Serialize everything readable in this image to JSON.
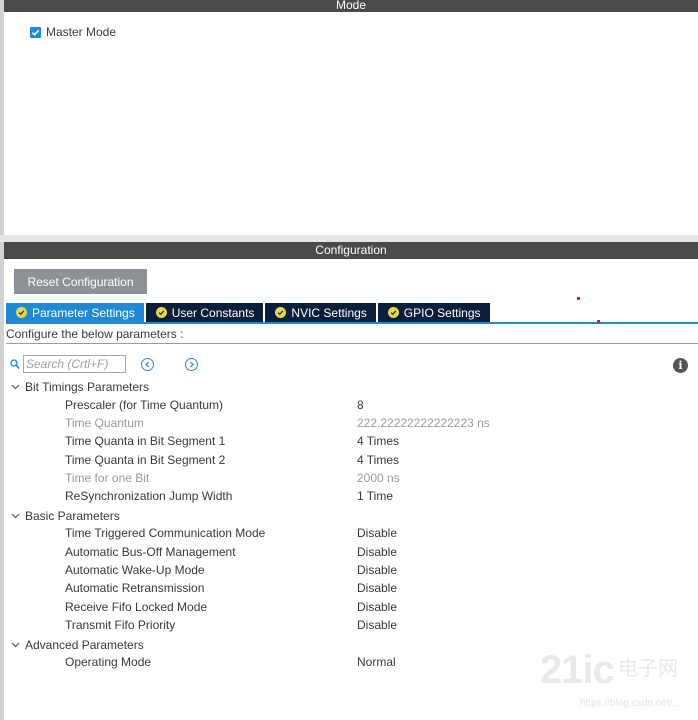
{
  "mode": {
    "header": "Mode",
    "master_mode": {
      "label": "Master Mode",
      "checked": true
    }
  },
  "configuration": {
    "header": "Configuration",
    "reset_label": "Reset Configuration",
    "tabs": [
      {
        "label": "Parameter Settings",
        "active": true
      },
      {
        "label": "User Constants",
        "active": false
      },
      {
        "label": "NVIC Settings",
        "active": false
      },
      {
        "label": "GPIO Settings",
        "active": false
      }
    ],
    "description": "Configure the below parameters :",
    "search": {
      "placeholder": "Search (Crtl+F)",
      "value": ""
    },
    "groups": [
      {
        "label": "Bit Timings Parameters",
        "params": [
          {
            "name": "Prescaler (for Time Quantum)",
            "value": "8",
            "disabled": false
          },
          {
            "name": "Time Quantum",
            "value": "222.22222222222223 ns",
            "disabled": true
          },
          {
            "name": "Time Quanta in Bit Segment 1",
            "value": "4 Times",
            "disabled": false
          },
          {
            "name": "Time Quanta in Bit Segment 2",
            "value": "4 Times",
            "disabled": false
          },
          {
            "name": "Time for one Bit",
            "value": "2000 ns",
            "disabled": true
          },
          {
            "name": "ReSynchronization Jump Width",
            "value": "1 Time",
            "disabled": false
          }
        ]
      },
      {
        "label": "Basic Parameters",
        "params": [
          {
            "name": "Time Triggered Communication Mode",
            "value": "Disable",
            "disabled": false
          },
          {
            "name": "Automatic Bus-Off Management",
            "value": "Disable",
            "disabled": false
          },
          {
            "name": "Automatic Wake-Up Mode",
            "value": "Disable",
            "disabled": false
          },
          {
            "name": "Automatic Retransmission",
            "value": "Disable",
            "disabled": false
          },
          {
            "name": "Receive Fifo Locked Mode",
            "value": "Disable",
            "disabled": false
          },
          {
            "name": "Transmit Fifo Priority",
            "value": "Disable",
            "disabled": false
          }
        ]
      },
      {
        "label": "Advanced Parameters",
        "params": [
          {
            "name": "Operating Mode",
            "value": "Normal",
            "disabled": false
          }
        ]
      }
    ]
  },
  "watermark": {
    "logo": "21ic",
    "cn": "电子网",
    "url": "https://blog.csdn.net/..."
  },
  "colors": {
    "accent": "#1f8ad3",
    "header_bg": "#4a4a4a",
    "tab_bg": "#0b1e3b",
    "reset_bg": "#8e9195"
  }
}
